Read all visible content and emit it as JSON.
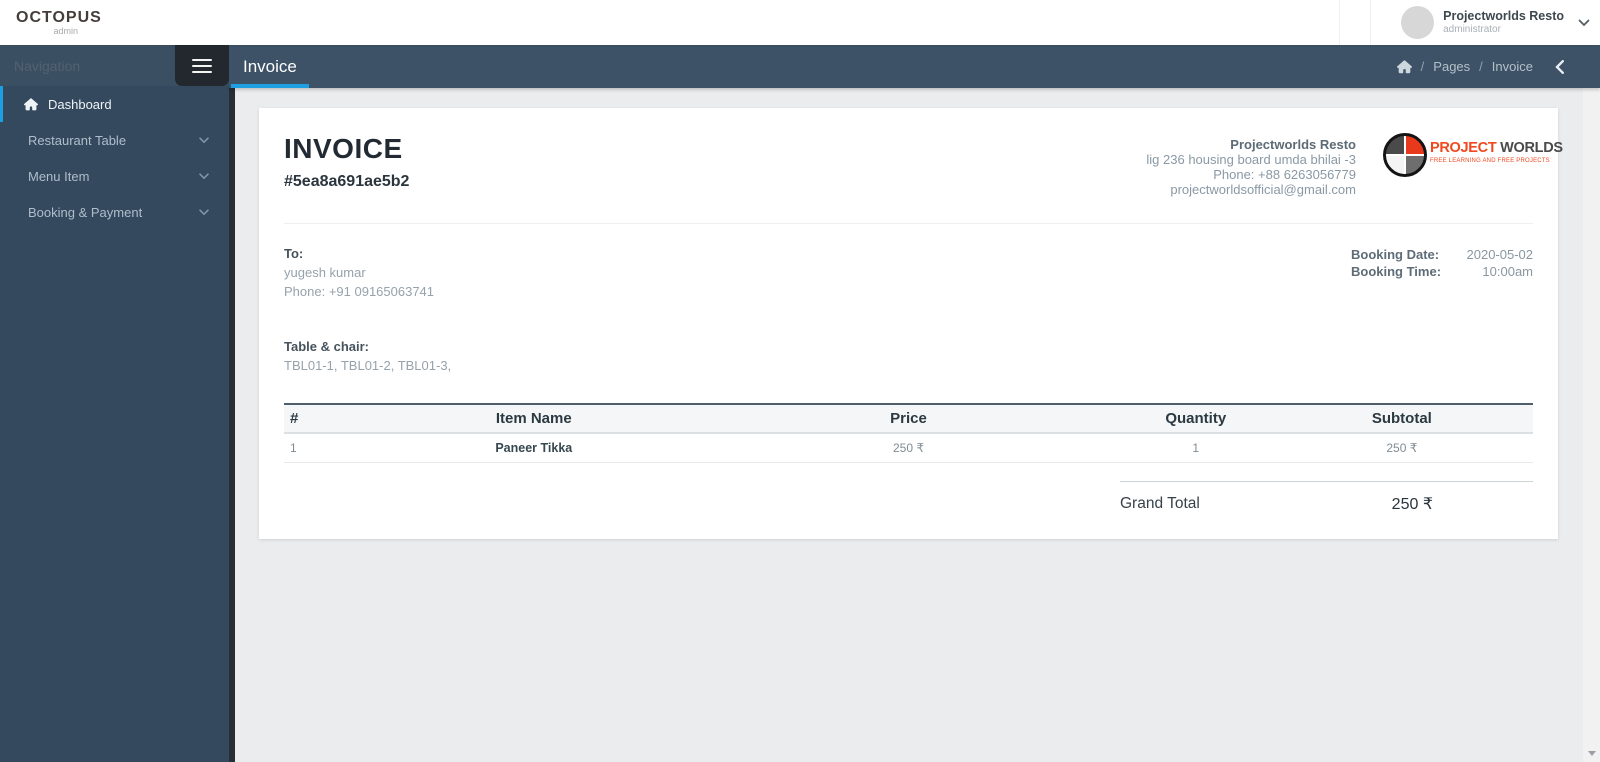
{
  "colors": {
    "accent_blue": "#1d9fe2",
    "sidebar_bg": "#34495e",
    "header_bg": "#3d5266",
    "topbar_bg": "#ffffff",
    "content_bg": "#eaecee",
    "brand_orange": "#f0491f"
  },
  "topbar": {
    "logo": "OCTOPUS",
    "logo_sub": "admin",
    "user": {
      "name": "Projectworlds Resto",
      "role": "administrator"
    }
  },
  "sidebar": {
    "nav_placeholder": "Navigation",
    "items": [
      {
        "label": "Dashboard",
        "icon": "home-icon",
        "active": true
      },
      {
        "label": "Restaurant Table",
        "icon": "chevron-down-icon"
      },
      {
        "label": "Menu Item",
        "icon": "chevron-down-icon"
      },
      {
        "label": "Booking & Payment",
        "icon": "chevron-down-icon"
      }
    ]
  },
  "header": {
    "title": "Invoice",
    "breadcrumb": {
      "home_icon": "home-icon",
      "separator": "/",
      "crumb1": "Pages",
      "crumb2": "Invoice"
    }
  },
  "invoice": {
    "title": "INVOICE",
    "number": "#5ea8a691ae5b2",
    "company": {
      "name": "Projectworlds Resto",
      "address": "lig 236 housing board umda bhilai -3",
      "phone": "Phone: +88 6263056779",
      "email": "projectworldsofficial@gmail.com"
    },
    "logo": {
      "brand_left": "PROJECT",
      "brand_right": " WORLDS",
      "tagline": "FREE LEARNING AND FREE PROJECTS"
    },
    "to": {
      "label": "To:",
      "name": "yugesh kumar",
      "phone": "Phone: +91 09165063741"
    },
    "booking": {
      "date_label": "Booking Date:",
      "date_value": "2020-05-02",
      "time_label": "Booking Time:",
      "time_value": "10:00am"
    },
    "table_chair": {
      "label": "Table & chair:",
      "value": "TBL01-1, TBL01-2, TBL01-3,"
    },
    "items_table": {
      "headers": [
        "#",
        "Item Name",
        "Price",
        "Quantity",
        "Subtotal"
      ],
      "rows": [
        [
          "1",
          "Paneer Tikka",
          "250 ₹",
          "1",
          "250 ₹"
        ]
      ]
    },
    "grand_total": {
      "label": "Grand Total",
      "value": "250 ₹"
    }
  }
}
